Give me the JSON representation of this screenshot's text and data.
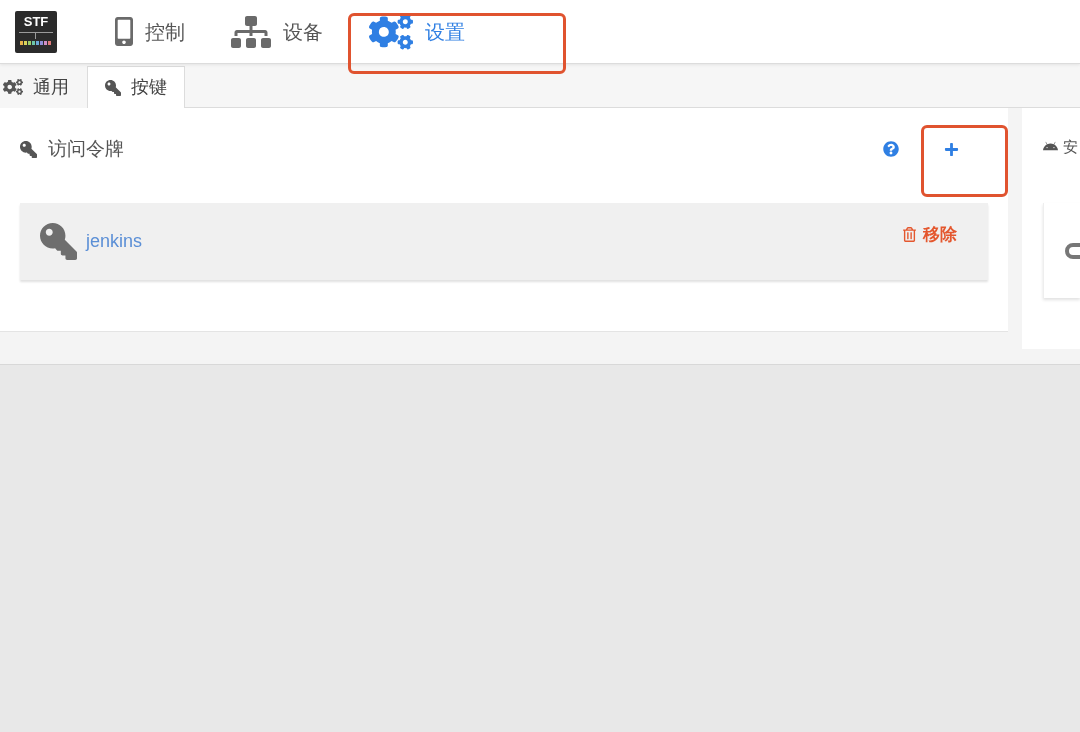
{
  "navbar": {
    "logo_text": "STF",
    "items": [
      {
        "kind": "phone",
        "label": "控制",
        "selected": false,
        "highlighted": false
      },
      {
        "kind": "sitemap",
        "label": "设备",
        "selected": false,
        "highlighted": false
      },
      {
        "kind": "gears",
        "label": "设置",
        "selected": true,
        "highlighted": true
      }
    ]
  },
  "tabs": [
    {
      "kind": "gears",
      "label": "通用",
      "selected": false
    },
    {
      "kind": "key",
      "label": "按键",
      "selected": true
    }
  ],
  "access_tokens": {
    "title": "访问令牌",
    "add_button": {
      "highlighted": true
    },
    "tokens": [
      {
        "name": "jenkins",
        "remove_label": "移除"
      }
    ]
  },
  "side_panel": {
    "title": "安"
  }
}
